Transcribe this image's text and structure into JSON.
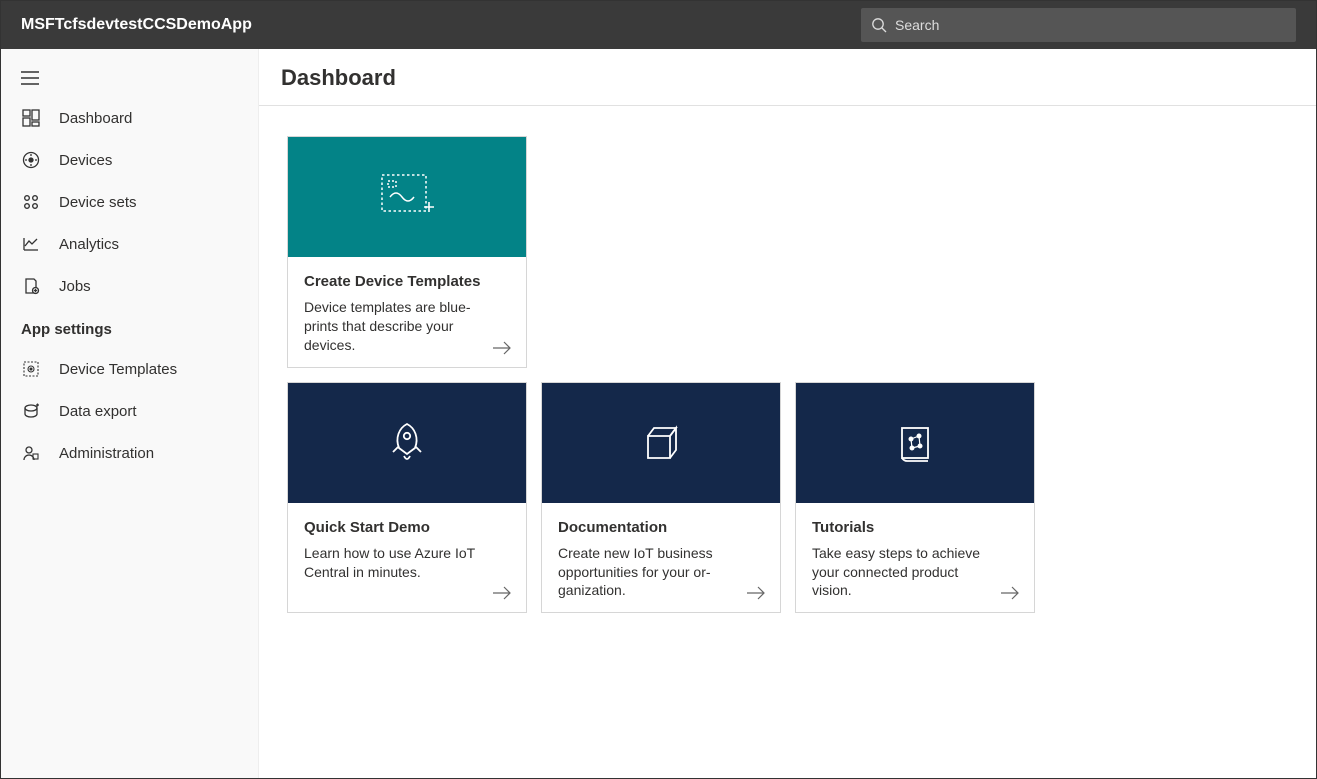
{
  "app_title": "MSFTcfsdevtestCCSDemoApp",
  "search": {
    "placeholder": "Search"
  },
  "nav": {
    "main": [
      {
        "label": "Dashboard",
        "icon": "dashboard-icon"
      },
      {
        "label": "Devices",
        "icon": "devices-icon"
      },
      {
        "label": "Device sets",
        "icon": "device-sets-icon"
      },
      {
        "label": "Analytics",
        "icon": "analytics-icon"
      },
      {
        "label": "Jobs",
        "icon": "jobs-icon"
      }
    ],
    "section_label": "App settings",
    "settings": [
      {
        "label": "Device Templates",
        "icon": "device-templates-icon"
      },
      {
        "label": "Data export",
        "icon": "data-export-icon"
      },
      {
        "label": "Administration",
        "icon": "administration-icon"
      }
    ]
  },
  "page": {
    "title": "Dashboard"
  },
  "cards": {
    "featured": {
      "title": "Create Device Templates",
      "desc": "Device templates are blue­prints that describe your devices.",
      "thumb_color": "green",
      "icon": "template-add-icon"
    },
    "row": [
      {
        "title": "Quick Start Demo",
        "desc": "Learn how to use Azure IoT Central in minutes.",
        "icon": "rocket-icon"
      },
      {
        "title": "Documentation",
        "desc": "Create new IoT business opportunities for your or­ganization.",
        "icon": "docs-icon"
      },
      {
        "title": "Tutorials",
        "desc": "Take easy steps to achieve your connected product vision.",
        "icon": "tutorial-icon"
      }
    ]
  }
}
